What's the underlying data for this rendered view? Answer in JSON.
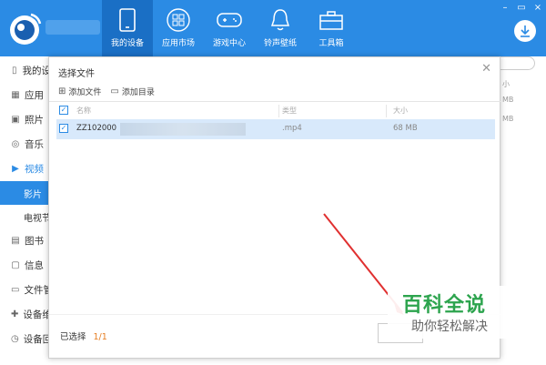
{
  "nav": {
    "items": [
      {
        "label": "我的设备",
        "icon": "phone-icon"
      },
      {
        "label": "应用市场",
        "icon": "apps-grid-icon"
      },
      {
        "label": "游戏中心",
        "icon": "gamepad-icon"
      },
      {
        "label": "铃声壁纸",
        "icon": "bell-icon"
      },
      {
        "label": "工具箱",
        "icon": "toolbox-icon"
      }
    ]
  },
  "window_controls": [
    "–",
    "▭",
    "×"
  ],
  "sidebar": {
    "items": [
      {
        "label": "我的设",
        "icon": "phone-icon"
      },
      {
        "label": "应用",
        "icon": "apps-icon"
      },
      {
        "label": "照片",
        "icon": "photo-icon"
      },
      {
        "label": "音乐",
        "icon": "music-icon"
      },
      {
        "label": "视频",
        "icon": "video-icon"
      },
      {
        "label": "影片",
        "sub": true,
        "selected": true
      },
      {
        "label": "电视节",
        "sub": true
      },
      {
        "label": "图书",
        "icon": "book-icon"
      },
      {
        "label": "信息",
        "icon": "message-icon"
      },
      {
        "label": "文件管",
        "icon": "folder-icon"
      },
      {
        "label": "设备维",
        "icon": "wrench-icon"
      },
      {
        "label": "设备回",
        "icon": "backup-icon"
      }
    ]
  },
  "background": {
    "col_header": "小",
    "sizes": [
      "MB",
      "MB"
    ]
  },
  "dialog": {
    "title": "选择文件",
    "toolbar": {
      "add_file": "添加文件",
      "add_folder": "添加目录"
    },
    "columns": {
      "name": "名称",
      "type": "类型",
      "size": "大小"
    },
    "rows": [
      {
        "name": "ZZ102000",
        "type": ".mp4",
        "size": "68 MB"
      }
    ],
    "footer": {
      "selected_label": "已选择",
      "selected_count": "1/1"
    }
  },
  "watermark": {
    "title": "百科全说",
    "subtitle": "助你轻松解决"
  },
  "colors": {
    "accent": "#2b8be4",
    "selected_row": "#d8e9fb",
    "count": "#e67e22",
    "watermark": "#2da44e",
    "arrow": "#e03030"
  }
}
